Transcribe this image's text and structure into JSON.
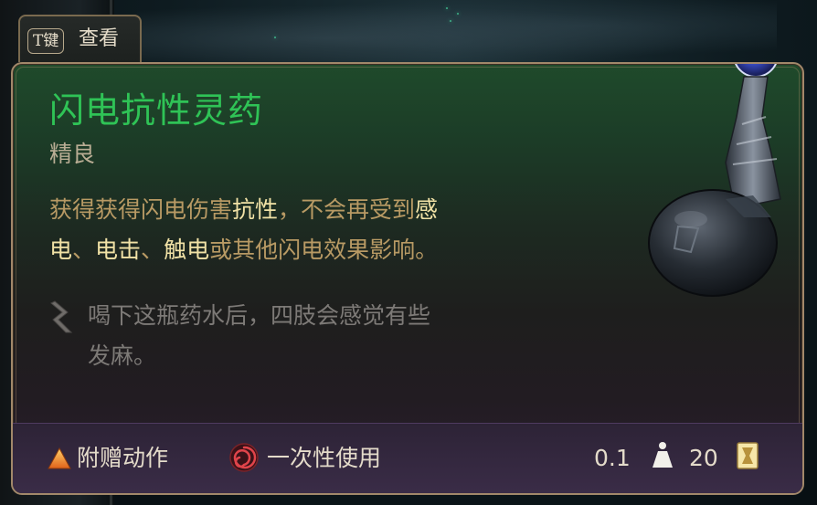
{
  "key_hint": {
    "key": "T键",
    "label": "查看"
  },
  "item": {
    "name": "闪电抗性灵药",
    "rarity": "精良",
    "description": {
      "line1_a": "获得获得闪电伤害",
      "line1_b": "抗性",
      "line1_c": "，不会再受到",
      "line1_d": "感",
      "line2_a": "电",
      "line2_b": "、",
      "line2_c": "电击",
      "line2_d": "、",
      "line2_e": "触电",
      "line2_f": "或其他闪电效果影响。"
    },
    "flavor": {
      "line1": "喝下这瓶药水后，四肢会感觉有些",
      "line2": "发麻。"
    }
  },
  "footer": {
    "action_label": "附赠动作",
    "usage_label": "一次性使用",
    "weight": "0.1",
    "value": "20"
  },
  "colors": {
    "name_green": "#2fc356",
    "highlight": "#f1e2a6",
    "desc_gold": "#b89a64",
    "border_gold": "#a2886a",
    "action_orange": "#f08a1c",
    "usage_red": "#c8343a"
  },
  "icons": {
    "action": "bonus-action-triangle-icon",
    "usage": "single-use-spiral-icon",
    "weight": "weight-icon",
    "value": "gold-value-icon",
    "flavor": "scroll-quill-icon",
    "item": "potion-bottle-icon"
  }
}
